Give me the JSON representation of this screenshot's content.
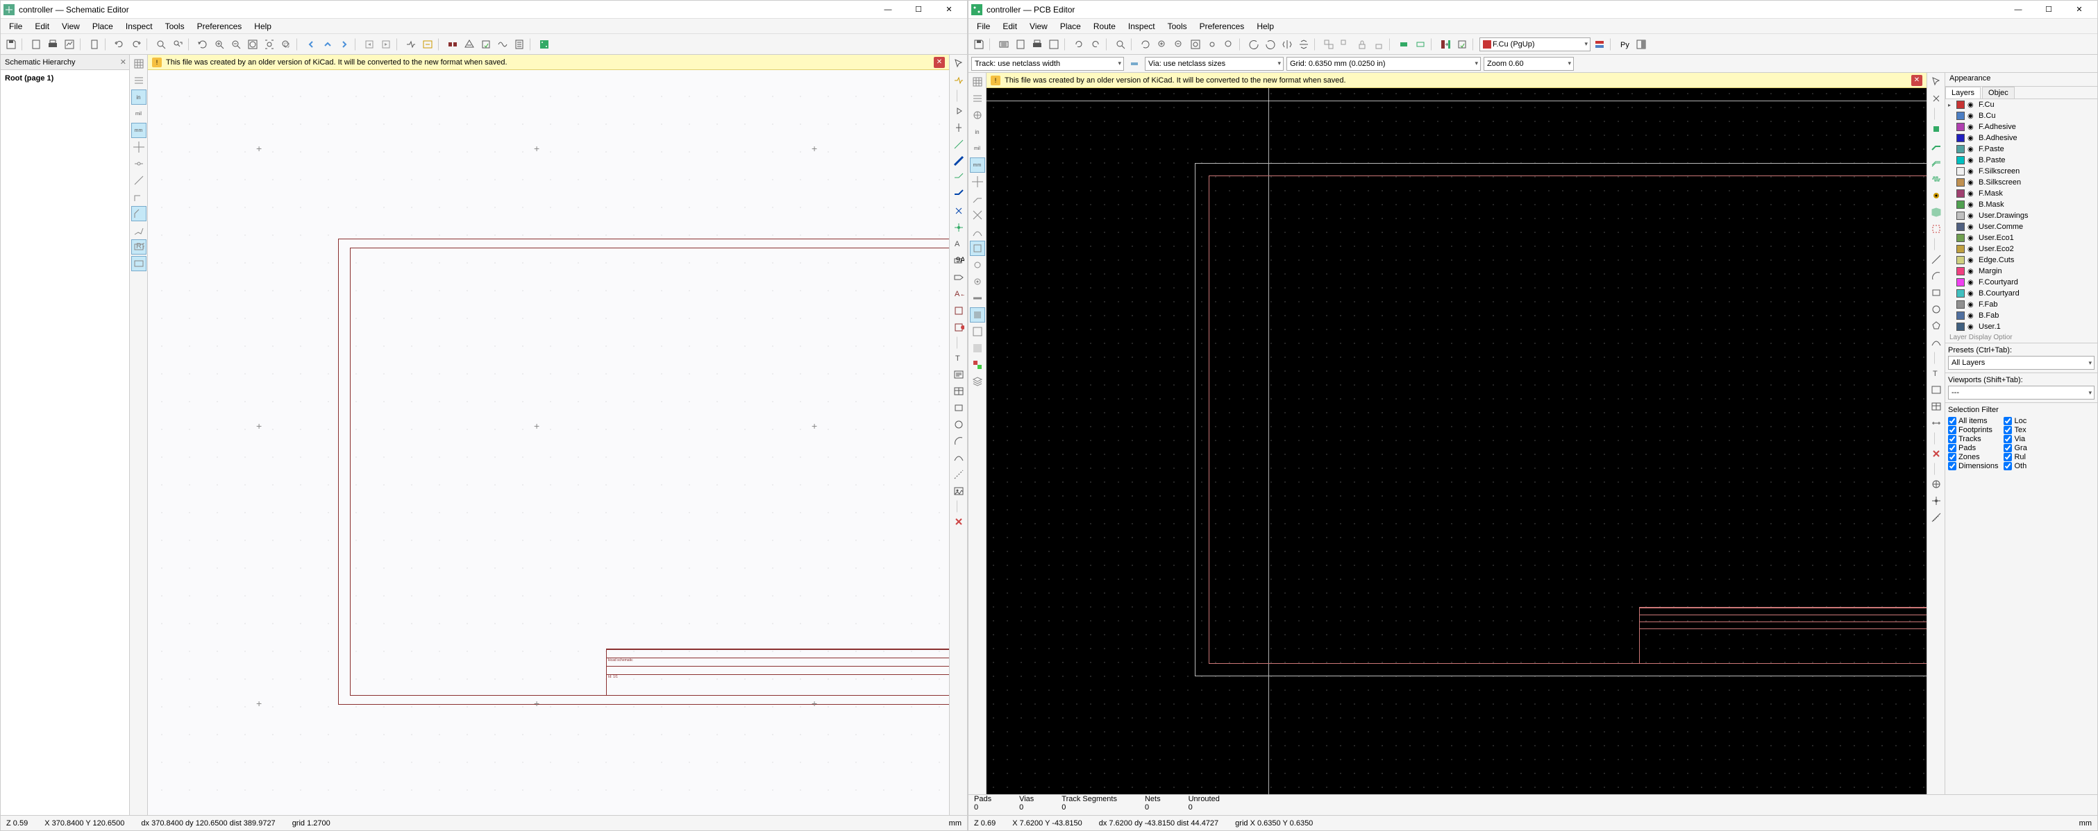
{
  "schematic": {
    "title": "controller — Schematic Editor",
    "menus": [
      "File",
      "Edit",
      "View",
      "Place",
      "Inspect",
      "Tools",
      "Preferences",
      "Help"
    ],
    "hierarchy_header": "Schematic Hierarchy",
    "root_label": "Root (page 1)",
    "warn": "This file was created by an older version of KiCad. It will be converted to the new format when saved.",
    "status": {
      "z": "Z 0.59",
      "xy": "X 370.8400  Y 120.6500",
      "dxy": "dx 370.8400  dy 120.6500  dist 389.9727",
      "grid": "grid 1.2700",
      "unit": "mm"
    }
  },
  "pcb": {
    "title": "controller — PCB Editor",
    "menus": [
      "File",
      "Edit",
      "View",
      "Place",
      "Route",
      "Inspect",
      "Tools",
      "Preferences",
      "Help"
    ],
    "track_dd": "Track: use netclass width",
    "via_dd": "Via: use netclass sizes",
    "grid_dd": "Grid: 0.6350 mm (0.0250 in)",
    "zoom_dd": "Zoom 0.60",
    "layer_dd": "F.Cu (PgUp)",
    "warn": "This file was created by an older version of KiCad. It will be converted to the new format when saved.",
    "appearance": {
      "header": "Appearance",
      "tabs": [
        "Layers",
        "Objec"
      ],
      "layers": [
        {
          "name": "F.Cu",
          "color": "#c83434"
        },
        {
          "name": "B.Cu",
          "color": "#4d7fc4"
        },
        {
          "name": "F.Adhesive",
          "color": "#b040b0"
        },
        {
          "name": "B.Adhesive",
          "color": "#2020c0"
        },
        {
          "name": "F.Paste",
          "color": "#50a0a0"
        },
        {
          "name": "B.Paste",
          "color": "#00c0c0"
        },
        {
          "name": "F.Silkscreen",
          "color": "#f0f0f0"
        },
        {
          "name": "B.Silkscreen",
          "color": "#c09050"
        },
        {
          "name": "F.Mask",
          "color": "#a04070"
        },
        {
          "name": "B.Mask",
          "color": "#50a050"
        },
        {
          "name": "User.Drawings",
          "color": "#c0c0c0"
        },
        {
          "name": "User.Comme",
          "color": "#506080"
        },
        {
          "name": "User.Eco1",
          "color": "#70a050"
        },
        {
          "name": "User.Eco2",
          "color": "#c0a040"
        },
        {
          "name": "Edge.Cuts",
          "color": "#d0d080"
        },
        {
          "name": "Margin",
          "color": "#f04080"
        },
        {
          "name": "F.Courtyard",
          "color": "#f040f0"
        },
        {
          "name": "B.Courtyard",
          "color": "#40c0c0"
        },
        {
          "name": "F.Fab",
          "color": "#909090"
        },
        {
          "name": "B.Fab",
          "color": "#5070a0"
        },
        {
          "name": "User.1",
          "color": "#406080"
        }
      ],
      "layer_display_opt": "Layer Display Optior",
      "presets_lbl": "Presets (Ctrl+Tab):",
      "presets_val": "All Layers",
      "viewports_lbl": "Viewports (Shift+Tab):",
      "viewports_val": "---",
      "selfilter_hdr": "Selection Filter",
      "filters_left": [
        "All items",
        "Footprints",
        "Tracks",
        "Pads",
        "Zones",
        "Dimensions"
      ],
      "filters_right": [
        "Loc",
        "Tex",
        "Via",
        "Gra",
        "Rul",
        "Oth"
      ]
    },
    "statextra": {
      "pads_lbl": "Pads",
      "pads_val": "0",
      "vias_lbl": "Vias",
      "vias_val": "0",
      "ts_lbl": "Track Segments",
      "ts_val": "0",
      "nets_lbl": "Nets",
      "nets_val": "0",
      "unr_lbl": "Unrouted",
      "unr_val": "0"
    },
    "status": {
      "z": "Z 0.69",
      "xy": "X 7.6200  Y -43.8150",
      "dxy": "dx 7.6200  dy -43.8150  dist 44.4727",
      "grid": "grid X 0.6350  Y 0.6350",
      "unit": "mm"
    }
  }
}
